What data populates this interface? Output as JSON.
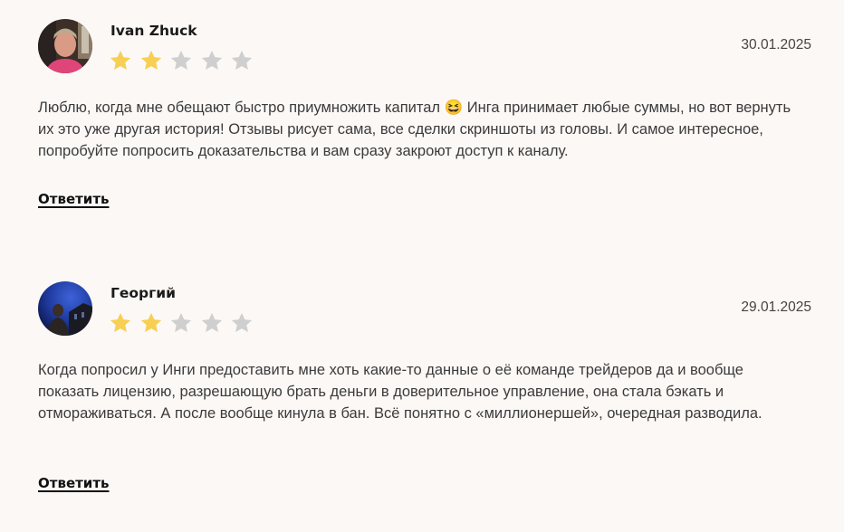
{
  "reviews": [
    {
      "author": "Ivan Zhuck",
      "date": "30.01.2025",
      "rating": 2,
      "max_rating": 5,
      "text": "Люблю, когда мне обещают быстро приумножить капитал 😆 Инга принимает любые суммы, но вот вернуть их это уже другая история! Отзывы рисует сама, все сделки скриншоты из головы. И самое интересное, попробуйте попросить доказательства и вам сразу закроют доступ к каналу.",
      "reply_label": "Ответить",
      "avatar_icon": "user-photo-icon"
    },
    {
      "author": "Георгий",
      "date": "29.01.2025",
      "rating": 2,
      "max_rating": 5,
      "text": "Когда попросил у Инги предоставить мне хоть какие-то данные о её команде трейдеров да и вообще показать лицензию, разрешающую брать деньги в доверительное управление, она стала бэкать и отмораживаться. А после вообще кинула в бан. Всё понятно с «миллионершей», очередная разводила.",
      "reply_label": "Ответить",
      "avatar_icon": "user-photo-icon"
    }
  ],
  "colors": {
    "background": "#fcf8f6",
    "star_filled": "#f7cf53",
    "star_empty": "#cfcfcf",
    "text": "#3b3b3b",
    "heading": "#1b1b1b"
  }
}
